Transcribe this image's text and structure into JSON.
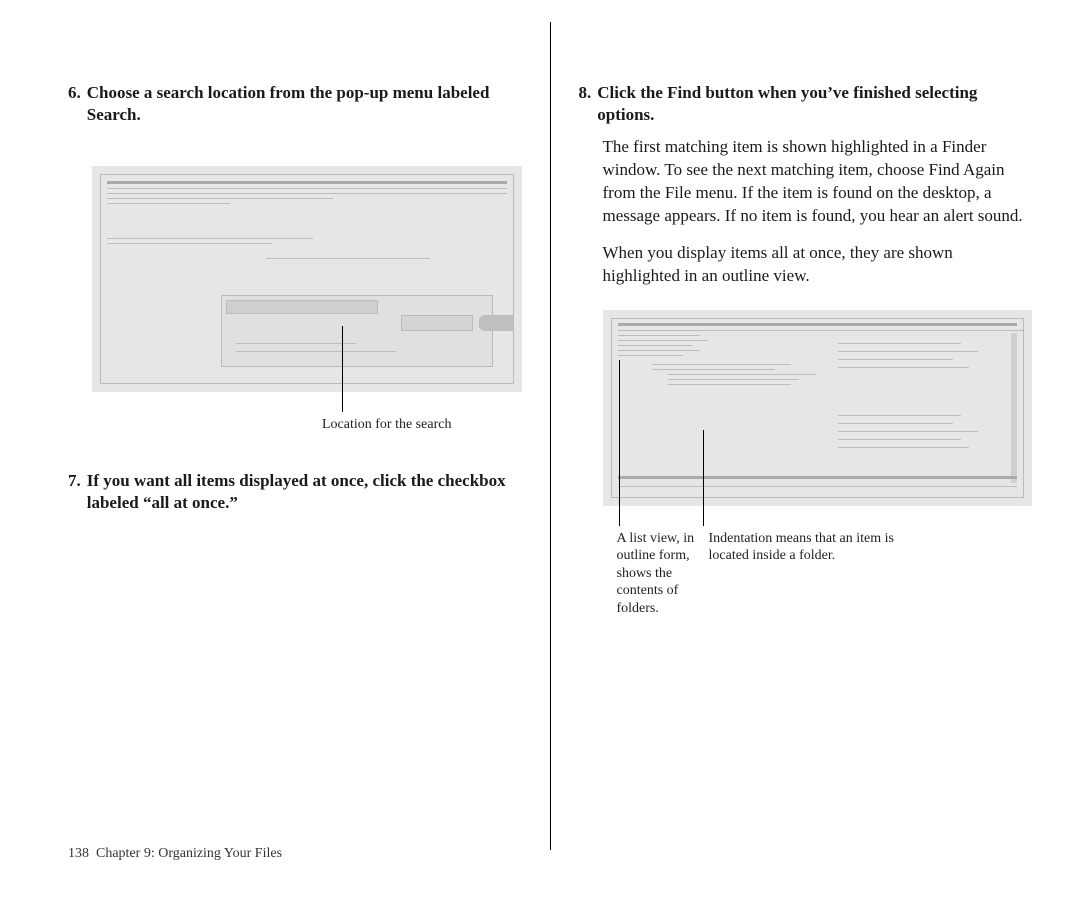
{
  "left": {
    "step6": {
      "num": "6.",
      "title": "Choose a search location from the pop-up menu labeled Search."
    },
    "fig1_caption": "Location for the search",
    "step7": {
      "num": "7.",
      "title": "If you want all items displayed at once, click the checkbox labeled “all at once.”"
    }
  },
  "right": {
    "step8": {
      "num": "8.",
      "title": "Click the Find button when you’ve finished selecting options.",
      "para1": "The first matching item is shown highlighted in a Finder window. To see the next matching item, choose Find Again from the File menu. If the item is found on the desktop, a message appears. If no item is found, you hear an alert sound.",
      "para2": "When you display items all at once, they are shown highlighted in an outline view."
    },
    "fig2_caption_left": "A list view, in outline form, shows the contents of folders.",
    "fig2_caption_right": "Indentation means that an item is located inside a folder."
  },
  "footer": {
    "page": "138",
    "chapter": " Chapter 9: Organizing Your Files"
  }
}
